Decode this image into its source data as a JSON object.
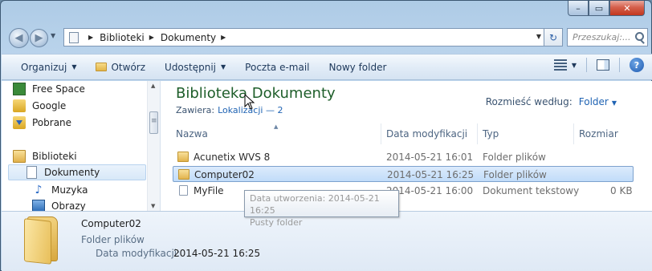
{
  "window": {
    "controls": [
      "–",
      "▭",
      "✕"
    ]
  },
  "address": {
    "crumbs": [
      "Biblioteki",
      "Dokumenty"
    ],
    "search_placeholder": "Przeszukaj:..."
  },
  "toolbar": {
    "organize": "Organizuj",
    "open": "Otwórz",
    "share": "Udostępnij",
    "email": "Poczta e-mail",
    "new_folder": "Nowy folder",
    "help": "?"
  },
  "nav": {
    "items": [
      {
        "label": "Free Space"
      },
      {
        "label": "Google"
      },
      {
        "label": "Pobrane"
      },
      {
        "label": "Biblioteki"
      },
      {
        "label": "Dokumenty"
      },
      {
        "label": "Muzyka"
      },
      {
        "label": "Obrazy"
      }
    ]
  },
  "library": {
    "title": "Biblioteka Dokumenty",
    "includes_label": "Zawiera:",
    "includes_link": "Lokalizacji — 2",
    "arrange_label": "Rozmieść według:",
    "arrange_value": "Folder"
  },
  "columns": {
    "name": "Nazwa",
    "modified": "Data modyfikacji",
    "type": "Typ",
    "size": "Rozmiar"
  },
  "files": [
    {
      "name": "Acunetix WVS 8",
      "modified": "2014-05-21 16:01",
      "type": "Folder plików",
      "size": ""
    },
    {
      "name": "Computer02",
      "modified": "2014-05-21 16:25",
      "type": "Folder plików",
      "size": ""
    },
    {
      "name": "MyFile",
      "modified": "2014-05-21 16:00",
      "type": "Dokument tekstowy",
      "size": "0 KB"
    }
  ],
  "tooltip": {
    "line1": "Data utworzenia: 2014-05-21 16:25",
    "line2": "Pusty folder"
  },
  "details": {
    "name": "Computer02",
    "type": "Folder plików",
    "modified_label": "Data modyfikacji:",
    "modified_value": "2014-05-21 16:25"
  }
}
